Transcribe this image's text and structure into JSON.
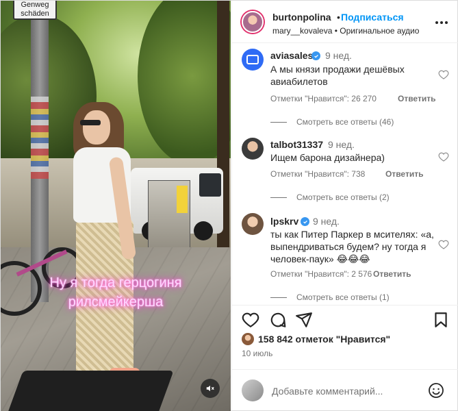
{
  "video": {
    "sign_line1": "Genweg",
    "sign_line2": "schäden",
    "caption_line1": "Ну я тогда герцогиня",
    "caption_line2": "рилсмейкерша",
    "mute_icon": "speaker-muted-icon"
  },
  "header": {
    "username": "burtonpolina",
    "separator": "•",
    "follow_label": "Подписаться",
    "subtitle": "mary__kovaleva • Оригинальное аудио",
    "more_icon": "more-horizontal-icon"
  },
  "comments": [
    {
      "username": "aviasales",
      "verified": true,
      "time": "9 нед.",
      "text": "А мы князи продажи дешёвых авиабилетов",
      "likes": "Отметки \"Нравится\": 26 270",
      "reply_label": "Ответить",
      "thread_label": "Смотреть все ответы (46)"
    },
    {
      "username": "talbot31337",
      "verified": false,
      "time": "9 нед.",
      "text": "Ищем барона дизайнера)",
      "likes": "Отметки \"Нравится\": 738",
      "reply_label": "Ответить",
      "thread_label": "Смотреть все ответы (2)"
    },
    {
      "username": "lpskrv",
      "verified": true,
      "time": "9 нед.",
      "text": "ты как Питер Паркер в мсителях: «а, выпендриваться будем? ну тогда я человек-паук» 😂😂😂",
      "likes": "Отметки \"Нравится\": 2 576",
      "reply_label": "Ответить",
      "thread_label": "Смотреть все ответы (1)"
    }
  ],
  "post": {
    "likes_text": "158 842 отметок \"Нравится\"",
    "date": "10 июль"
  },
  "add_comment": {
    "placeholder": "Добавьте комментарий..."
  },
  "colors": {
    "accent": "#0095f6",
    "verified": "#3897f0",
    "muted_text": "#737373",
    "caption_glow": "#ff4fd8"
  }
}
